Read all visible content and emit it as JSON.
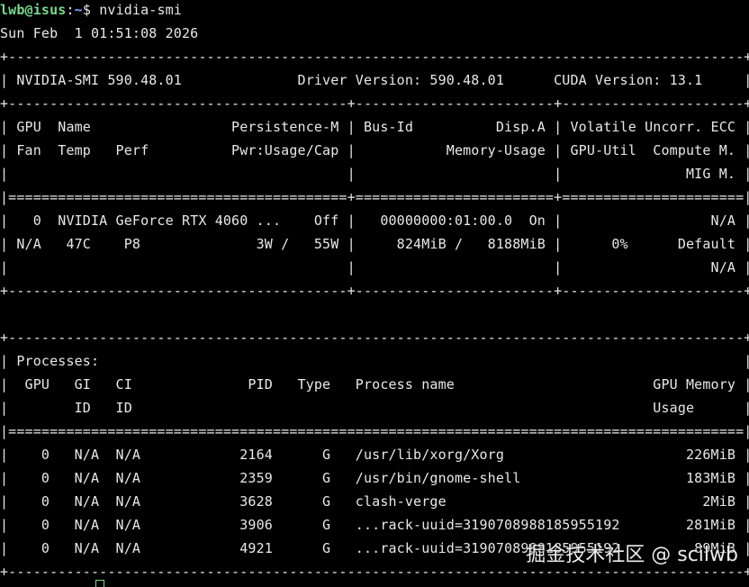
{
  "prompt": {
    "user_host": "lwb@isus",
    "separator": ":",
    "path": "~",
    "symbol": "$ ",
    "command": "nvidia-smi"
  },
  "timestamp": "Sun Feb  1 01:51:08 2026",
  "smi_table": {
    "border": "+-----------------------------------------------------------------------------------------+",
    "version_line": "| NVIDIA-SMI 590.48.01              Driver Version: 590.48.01      CUDA Version: 13.1     |",
    "header_sep": "+-----------------------------------------+------------------------+----------------------+",
    "header_row1": "| GPU  Name                 Persistence-M | Bus-Id          Disp.A | Volatile Uncorr. ECC |",
    "header_row2": "| Fan  Temp   Perf          Pwr:Usage/Cap |           Memory-Usage | GPU-Util  Compute M. |",
    "header_row3": "|                                         |                        |               MIG M. |",
    "double_sep": "|=========================================+========================+======================|",
    "gpu_row1": "|   0  NVIDIA GeForce RTX 4060 ...    Off |   00000000:01:00.0  On |                  N/A |",
    "gpu_row2": "| N/A   47C    P8              3W /   55W |     824MiB /   8188MiB |      0%      Default |",
    "gpu_row3": "|                                         |                        |                  N/A |",
    "bottom_sep": "+-----------------------------------------+------------------------+----------------------+"
  },
  "processes_table": {
    "top": "+-----------------------------------------------------------------------------------------+",
    "title": "| Processes:                                                                              |",
    "header1": "|  GPU   GI   CI              PID   Type   Process name                        GPU Memory |",
    "header2": "|        ID   ID                                                               Usage      |",
    "double_sep": "|=========================================================================================|",
    "rows": [
      "|    0   N/A  N/A            2164      G   /usr/lib/xorg/Xorg                      226MiB |",
      "|    0   N/A  N/A            2359      G   /usr/bin/gnome-shell                    183MiB |",
      "|    0   N/A  N/A            3628      G   clash-verge                               2MiB |",
      "|    0   N/A  N/A            3906      G   ...rack-uuid=3190708988185955192        281MiB |",
      "|    0   N/A  N/A            4921      G   ...rack-uuid=3190708988185955192         89MiB |"
    ],
    "bottom": "+-----------------------------------------------------------------------------------------+"
  },
  "watermark": "掘金技术社区 @ scilwb"
}
